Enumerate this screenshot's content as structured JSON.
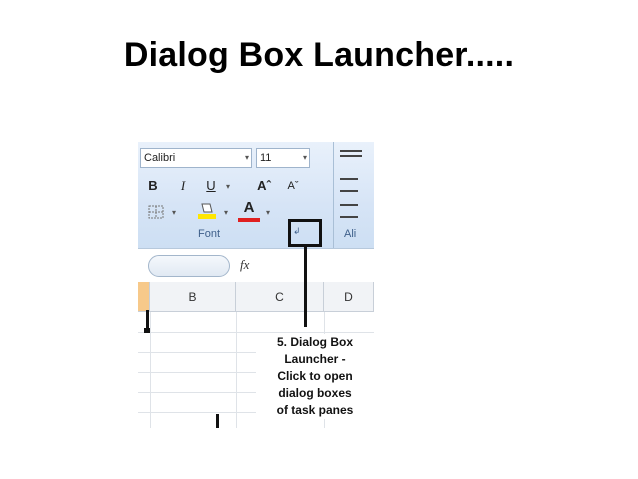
{
  "slide": {
    "title": "Dialog Box Launcher....."
  },
  "ribbon": {
    "font_name": "Calibri",
    "font_size": "11",
    "bold": "B",
    "italic": "I",
    "underline": "U",
    "grow_font": "Aˆ",
    "shrink_font": "Aˇ",
    "font_color_letter": "A",
    "font_group_label": "Font",
    "alignment_group_label": "Ali",
    "launcher_glyph": "↲"
  },
  "formula_bar": {
    "fx": "fx"
  },
  "columns": [
    "B",
    "C",
    "D"
  ],
  "callout": {
    "lines": [
      "5. Dialog Box",
      "Launcher -",
      "Click to open",
      "dialog boxes",
      "of task panes"
    ]
  },
  "colors": {
    "ribbon": "#d6e4f6",
    "label": "#3e5f8a",
    "font_color": "#e02020",
    "highlight": "#ffe600"
  }
}
